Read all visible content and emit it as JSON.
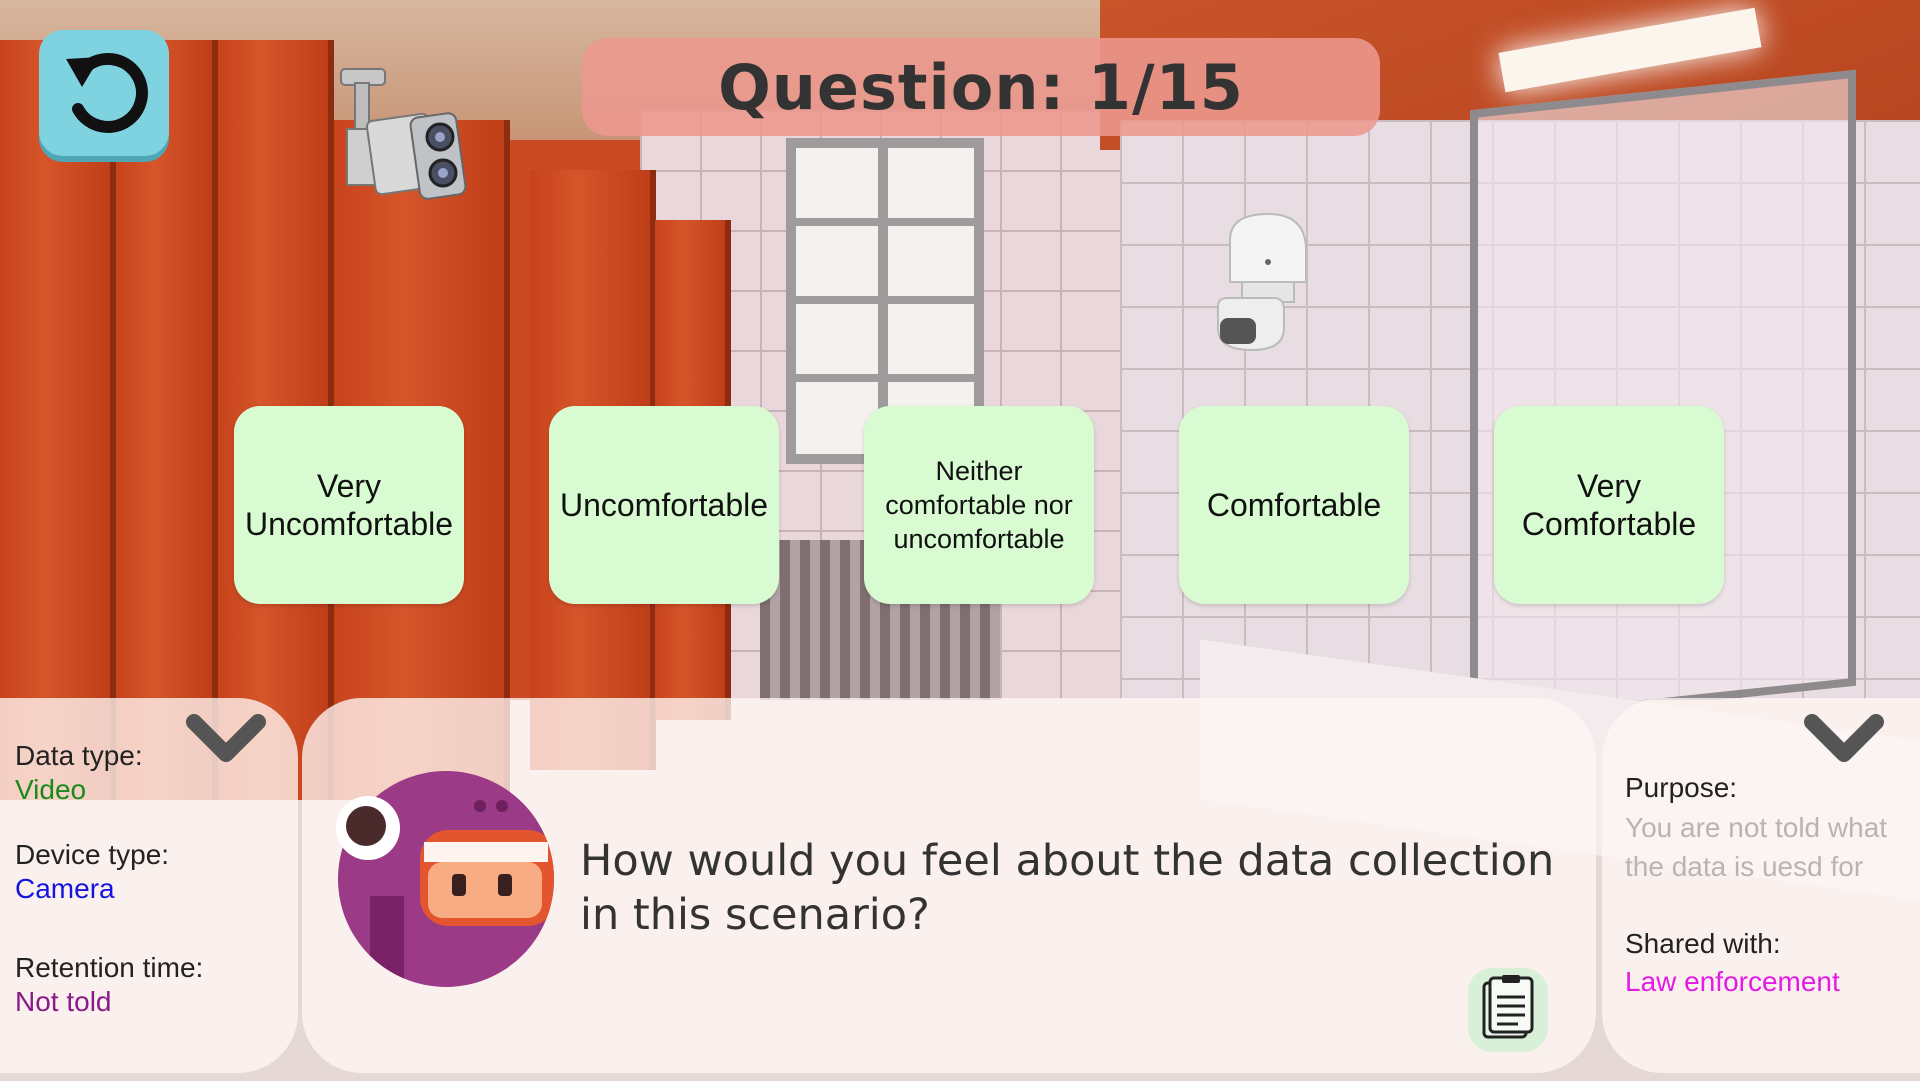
{
  "header": {
    "back_icon": "undo-icon",
    "question_label": "Question: 1/15"
  },
  "devices": {
    "camera_icon": "cctv-camera-icon",
    "sensor_icon": "motion-sensor-icon"
  },
  "options": [
    "Very Uncomfortable",
    "Uncomfortable",
    "Neither comfortable nor uncomfortable",
    "Comfortable",
    "Very Comfortable"
  ],
  "left_panel": {
    "data_type_label": "Data type:",
    "data_type_value": "Video",
    "device_type_label": "Device type:",
    "device_type_value": "Camera",
    "retention_label": "Retention time:",
    "retention_value": "Not told"
  },
  "right_panel": {
    "purpose_label": "Purpose:",
    "purpose_value_line1": "You are not told what",
    "purpose_value_line2": "the data is uesd for",
    "shared_label": "Shared with:",
    "shared_value": "Law enforcement"
  },
  "prompt": {
    "line1": "How would you feel about the data collection",
    "line2": "in this scenario?"
  },
  "colors": {
    "video": "#1a8a1a",
    "camera": "#1414e0",
    "not_told": "#8a1a8a",
    "law_enforcement": "#e41be4",
    "purpose_value": "#b9b4b4",
    "option_bg": "#d9fbd2",
    "banner_bg": "#ec988e",
    "back_button_bg": "#7fd3e0"
  }
}
